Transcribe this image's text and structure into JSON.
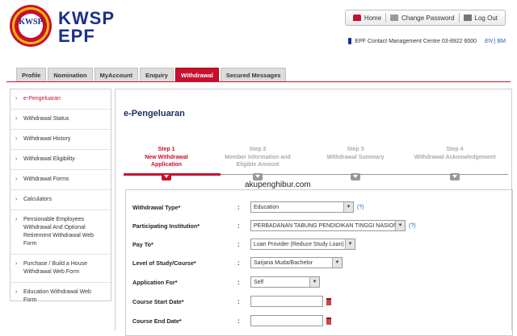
{
  "brand": {
    "monogram": "KWSP",
    "line1": "KWSP",
    "line2": "EPF"
  },
  "top_nav": {
    "home": "Home",
    "change_password": "Change Password",
    "logout": "Log Out"
  },
  "contact": {
    "text": "EPF Contact Management Centre 03-8922 6000",
    "lang_en": "EN",
    "lang_sep": "|",
    "lang_bm": "BM"
  },
  "tabs": [
    {
      "label": "Profile",
      "active": false
    },
    {
      "label": "Nomination",
      "active": false
    },
    {
      "label": "MyAccount",
      "active": false
    },
    {
      "label": "Enquiry",
      "active": false
    },
    {
      "label": "Withdrawal",
      "active": true
    },
    {
      "label": "Secured Messages",
      "active": false
    }
  ],
  "sidebar": {
    "items": [
      {
        "label": "e-Pengeluaran",
        "active": true
      },
      {
        "label": "Withdrawal Status",
        "active": false
      },
      {
        "label": "Withdrawal History",
        "active": false
      },
      {
        "label": "Withdrawal Eligibility",
        "active": false
      },
      {
        "label": "Withdrawal Forms",
        "active": false
      },
      {
        "label": "Calculators",
        "active": false
      },
      {
        "label": "Pensionable Employees Withdrawal And Optional Retirement Withdrawal Web Form",
        "active": false
      },
      {
        "label": "Purchase / Build a House Withdrawal Web Form",
        "active": false
      },
      {
        "label": "Education Withdrawal Web Form",
        "active": false
      }
    ]
  },
  "main": {
    "title": "e-Pengeluaran",
    "watermark": "akupenghibur.com",
    "steps": [
      {
        "num": "Step 1",
        "line1": "New Withdrawal",
        "line2": "Application",
        "active": true
      },
      {
        "num": "Step 2",
        "line1": "Member Information and",
        "line2": "Eligible Amount",
        "active": false
      },
      {
        "num": "Step 3",
        "line1": "Withdrawal Summary",
        "line2": "",
        "active": false
      },
      {
        "num": "Step 4",
        "line1": "Withdrawal Acknowledgement",
        "line2": "",
        "active": false
      }
    ]
  },
  "form": {
    "colon": ":",
    "help": "(?)",
    "withdrawal_type": {
      "label": "Withdrawal Type*",
      "value": "Education"
    },
    "institution": {
      "label": "Participating Institution*",
      "value": "PERBADANAN TABUNG PENDIDIKAN TINGGI NASIONAL"
    },
    "pay_to": {
      "label": "Pay To*",
      "value": "Loan Provider (Reduce Study Loan)"
    },
    "level_of_study": {
      "label": "Level of Study/Course*",
      "value": "Sarjana Muda/Bachelor"
    },
    "application_for": {
      "label": "Application For*",
      "value": "Self"
    },
    "course_start": {
      "label": "Course Start Date*",
      "value": ""
    },
    "course_end": {
      "label": "Course End Date*",
      "value": ""
    }
  },
  "colors": {
    "accent": "#c8102e",
    "brand_blue": "#1a2f8f"
  }
}
